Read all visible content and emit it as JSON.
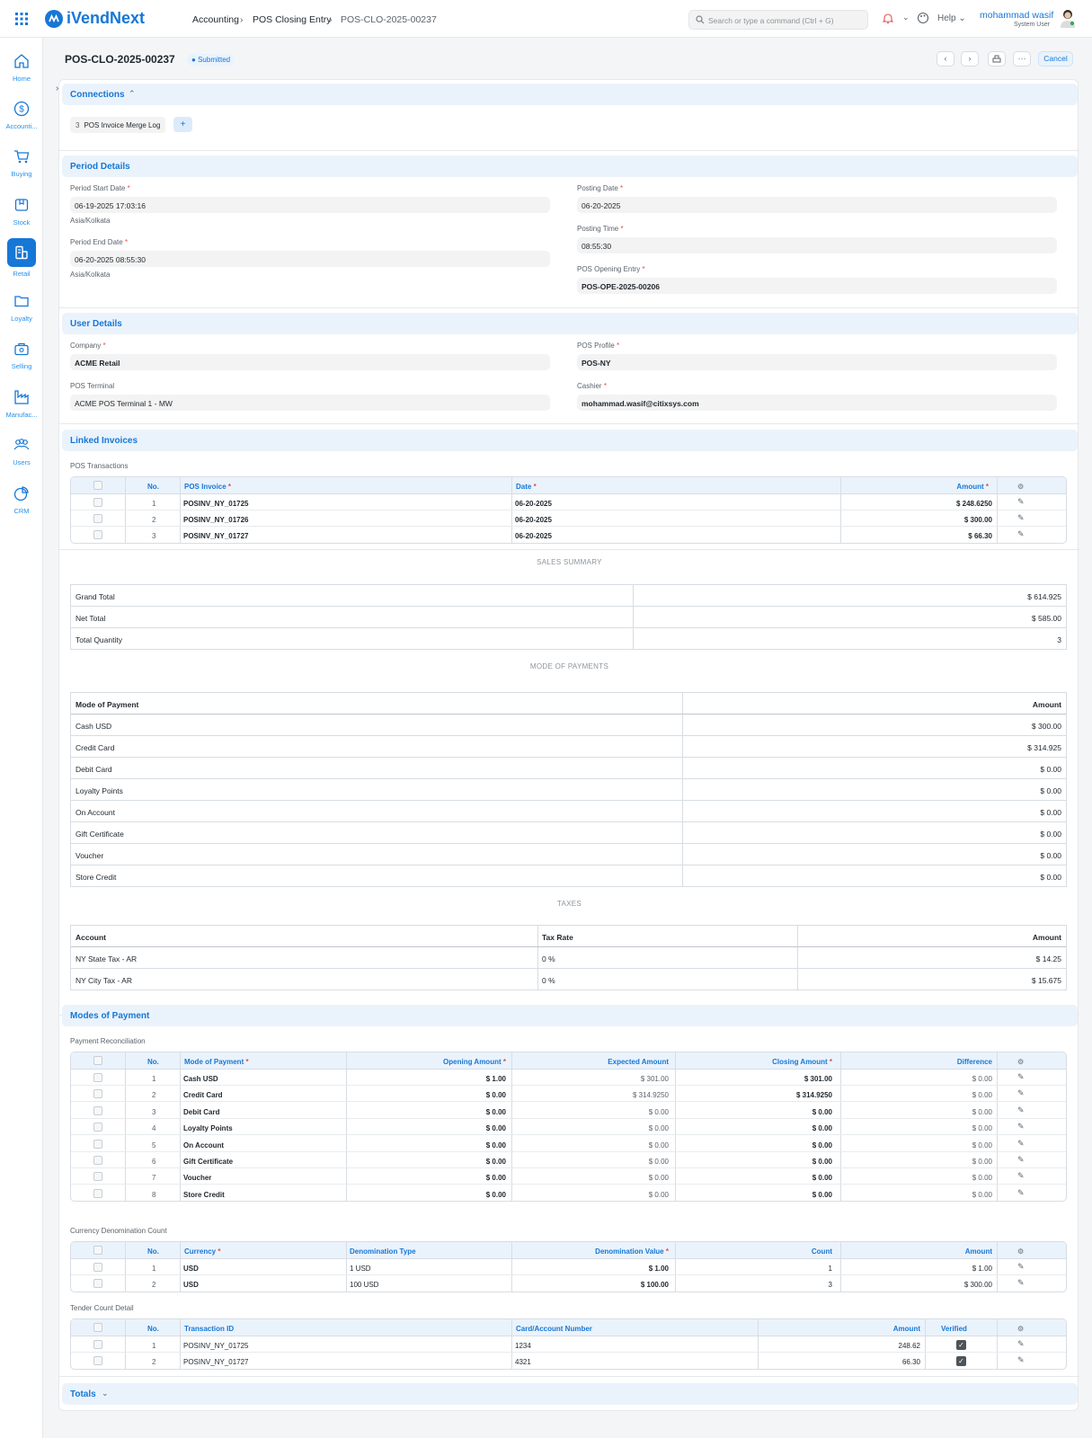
{
  "app": {
    "name": "iVendNext",
    "brand_color": "#1677d6"
  },
  "breadcrumbs": [
    "Accounting",
    "POS Closing Entry",
    "POS-CLO-2025-00237"
  ],
  "search": {
    "placeholder": "Search or type a command (Ctrl + G)"
  },
  "help_label": "Help",
  "user": {
    "name": "mohammad wasif",
    "role": "System User"
  },
  "sidebar": [
    {
      "label": "Home",
      "icon": "home-icon"
    },
    {
      "label": "Accounti...",
      "icon": "dollar-circle-icon"
    },
    {
      "label": "Buying",
      "icon": "cart-icon"
    },
    {
      "label": "Stock",
      "icon": "box-icon"
    },
    {
      "label": "Retail",
      "icon": "store-icon",
      "active": true
    },
    {
      "label": "Loyalty",
      "icon": "folder-icon"
    },
    {
      "label": "Selling",
      "icon": "bag-icon"
    },
    {
      "label": "Manufac...",
      "icon": "factory-icon"
    },
    {
      "label": "Users",
      "icon": "users-icon"
    },
    {
      "label": "CRM",
      "icon": "pie-chart-icon"
    }
  ],
  "page": {
    "title": "POS-CLO-2025-00237",
    "status": "Submitted",
    "cancel_label": "Cancel"
  },
  "connections": {
    "title": "Connections",
    "count": "3",
    "label": "POS Invoice Merge Log",
    "add": "+"
  },
  "period": {
    "title": "Period Details",
    "start_label": "Period Start Date",
    "start": "06-19-2025 17:03:16",
    "start_tz": "Asia/Kolkata",
    "end_label": "Period End Date",
    "end": "06-20-2025 08:55:30",
    "end_tz": "Asia/Kolkata",
    "posting_date_label": "Posting Date",
    "posting_date": "06-20-2025",
    "posting_time_label": "Posting Time",
    "posting_time": "08:55:30",
    "opening_label": "POS Opening Entry",
    "opening": "POS-OPE-2025-00206"
  },
  "user_details": {
    "title": "User Details",
    "company_label": "Company",
    "company": "ACME Retail",
    "terminal_label": "POS Terminal",
    "terminal": "ACME POS Terminal 1 - MW",
    "profile_label": "POS Profile",
    "profile": "POS-NY",
    "cashier_label": "Cashier",
    "cashier": "mohammad.wasif@citixsys.com"
  },
  "linked": {
    "title": "Linked Invoices",
    "sub": "POS Transactions",
    "headers": [
      "No.",
      "POS Invoice",
      "Date",
      "Amount"
    ],
    "rows": [
      [
        "1",
        "POSINV_NY_01725",
        "06-20-2025",
        "$ 248.6250"
      ],
      [
        "2",
        "POSINV_NY_01726",
        "06-20-2025",
        "$ 300.00"
      ],
      [
        "3",
        "POSINV_NY_01727",
        "06-20-2025",
        "$ 66.30"
      ]
    ]
  },
  "sales_summary": {
    "caption": "SALES SUMMARY",
    "rows": [
      [
        "Grand Total",
        "$ 614.925"
      ],
      [
        "Net Total",
        "$ 585.00"
      ],
      [
        "Total Quantity",
        "3"
      ]
    ]
  },
  "mode_payments": {
    "caption": "MODE OF PAYMENTS",
    "headers": [
      "Mode of Payment",
      "Amount"
    ],
    "rows": [
      [
        "Cash USD",
        "$ 300.00"
      ],
      [
        "Credit Card",
        "$ 314.925"
      ],
      [
        "Debit Card",
        "$ 0.00"
      ],
      [
        "Loyalty Points",
        "$ 0.00"
      ],
      [
        "On Account",
        "$ 0.00"
      ],
      [
        "Gift Certificate",
        "$ 0.00"
      ],
      [
        "Voucher",
        "$ 0.00"
      ],
      [
        "Store Credit",
        "$ 0.00"
      ]
    ]
  },
  "taxes": {
    "caption": "TAXES",
    "headers": [
      "Account",
      "Tax Rate",
      "Amount"
    ],
    "rows": [
      [
        "NY State Tax - AR",
        "0 %",
        "$ 14.25"
      ],
      [
        "NY City Tax - AR",
        "0 %",
        "$ 15.675"
      ]
    ]
  },
  "modes": {
    "title": "Modes of Payment",
    "sub": "Payment Reconciliation",
    "headers": [
      "No.",
      "Mode of Payment",
      "Opening Amount",
      "Expected Amount",
      "Closing Amount",
      "Difference"
    ],
    "rows": [
      [
        "1",
        "Cash USD",
        "$ 1.00",
        "$ 301.00",
        "$ 301.00",
        "$ 0.00"
      ],
      [
        "2",
        "Credit Card",
        "$ 0.00",
        "$ 314.9250",
        "$ 314.9250",
        "$ 0.00"
      ],
      [
        "3",
        "Debit Card",
        "$ 0.00",
        "$ 0.00",
        "$ 0.00",
        "$ 0.00"
      ],
      [
        "4",
        "Loyalty Points",
        "$ 0.00",
        "$ 0.00",
        "$ 0.00",
        "$ 0.00"
      ],
      [
        "5",
        "On Account",
        "$ 0.00",
        "$ 0.00",
        "$ 0.00",
        "$ 0.00"
      ],
      [
        "6",
        "Gift Certificate",
        "$ 0.00",
        "$ 0.00",
        "$ 0.00",
        "$ 0.00"
      ],
      [
        "7",
        "Voucher",
        "$ 0.00",
        "$ 0.00",
        "$ 0.00",
        "$ 0.00"
      ],
      [
        "8",
        "Store Credit",
        "$ 0.00",
        "$ 0.00",
        "$ 0.00",
        "$ 0.00"
      ]
    ]
  },
  "denom": {
    "sub": "Currency Denomination Count",
    "headers": [
      "No.",
      "Currency",
      "Denomination Type",
      "Denomination Value",
      "Count",
      "Amount"
    ],
    "rows": [
      [
        "1",
        "USD",
        "1 USD",
        "$ 1.00",
        "1",
        "$ 1.00"
      ],
      [
        "2",
        "USD",
        "100 USD",
        "$ 100.00",
        "3",
        "$ 300.00"
      ]
    ]
  },
  "tender": {
    "sub": "Tender Count Detail",
    "headers": [
      "No.",
      "Transaction ID",
      "Card/Account Number",
      "Amount",
      "Verified"
    ],
    "rows": [
      [
        "1",
        "POSINV_NY_01725",
        "1234",
        "248.62"
      ],
      [
        "2",
        "POSINV_NY_01727",
        "4321",
        "66.30"
      ]
    ]
  },
  "totals": {
    "title": "Totals"
  }
}
